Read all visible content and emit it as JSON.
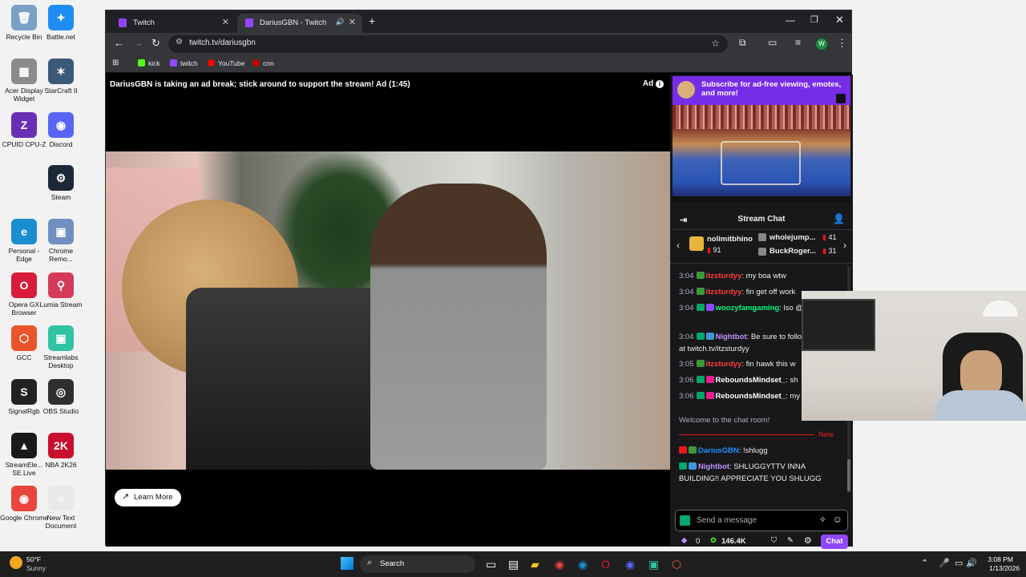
{
  "desktop": {
    "icons": [
      {
        "label": "Recycle Bin",
        "glyph": "🗑",
        "color": "#7aa0c7"
      },
      {
        "label": "Battle.net",
        "glyph": "✦",
        "color": "#1f8cf2"
      },
      {
        "label": "Acer Display Widget",
        "glyph": "▦",
        "color": "#8b8b8b"
      },
      {
        "label": "StarCraft II",
        "glyph": "✶",
        "color": "#3b5a7a"
      },
      {
        "label": "CPUID CPU-Z",
        "glyph": "Z",
        "color": "#6b2fb5"
      },
      {
        "label": "Discord",
        "glyph": "◉",
        "color": "#5865f2"
      },
      {
        "label": "Steam",
        "glyph": "⚙",
        "color": "#1b2838"
      },
      {
        "label": "Personal - Edge",
        "glyph": "e",
        "color": "#1a8fd0"
      },
      {
        "label": "Chrome Remo...",
        "glyph": "▣",
        "color": "#6f8fbf"
      },
      {
        "label": "Opera GX Browser",
        "glyph": "O",
        "color": "#d81b3a"
      },
      {
        "label": "Lumia Stream",
        "glyph": "⚲",
        "color": "#d63a5a"
      },
      {
        "label": "GCC",
        "glyph": "⬡",
        "color": "#e8552a"
      },
      {
        "label": "Streamlabs Desktop",
        "glyph": "▣",
        "color": "#31c3a2"
      },
      {
        "label": "SignalRgb",
        "glyph": "S",
        "color": "#222222"
      },
      {
        "label": "OBS Studio",
        "glyph": "◎",
        "color": "#302e31"
      },
      {
        "label": "StreamEle... SE.Live",
        "glyph": "▲",
        "color": "#1a1a1a"
      },
      {
        "label": "NBA 2K26",
        "glyph": "2K",
        "color": "#c8102e"
      },
      {
        "label": "Google Chrome",
        "glyph": "◉",
        "color": "#e8453c"
      },
      {
        "label": "New Text Document",
        "glyph": "≡",
        "color": "#e9e9e9"
      }
    ]
  },
  "browser": {
    "tabs": [
      {
        "title": "Twitch",
        "active": false
      },
      {
        "title": "DariusGBN - Twitch",
        "active": true
      }
    ],
    "new_tab": "+",
    "url": "twitch.tv/dariusgbn",
    "profile_initial": "W",
    "bookmarks": [
      {
        "label": "kick",
        "color": "#53fc18"
      },
      {
        "label": "twitch",
        "color": "#9147ff"
      },
      {
        "label": "YouTube",
        "color": "#ff0000"
      },
      {
        "label": "cnn",
        "color": "#cc0000"
      }
    ]
  },
  "player": {
    "ad_message": "DariusGBN is taking an ad break; stick around to support the stream! Ad (1:45)",
    "ad_badge": "Ad",
    "learn_more": "Learn More"
  },
  "sidebar": {
    "promo": "Subscribe for ad-free viewing, emotes, and more!",
    "chat_title": "Stream Chat",
    "gifters": [
      {
        "name": "nolimitbhino",
        "count": "91"
      },
      {
        "name": "wholejump...",
        "count": "41"
      },
      {
        "name": "BuckRoger...",
        "count": "31"
      }
    ],
    "messages": [
      {
        "time": "3:04",
        "user": "itzsturdyy",
        "color": "#ff3b3b",
        "text": "my boa wtw"
      },
      {
        "time": "3:04",
        "user": "itzsturdyy",
        "color": "#ff3b3b",
        "text": "fin get off work"
      },
      {
        "time": "3:04",
        "user": "woozyfamgaming",
        "color": "#00ff7f",
        "text": "lso @itzsturdyy"
      },
      {
        "time": "3:04",
        "user": "Nightbot",
        "color": "#bf94ff",
        "text": "Be sure to follow itzsturdyy at twitch.tv/itzsturdyy"
      },
      {
        "time": "3:05",
        "user": "itzsturdyy",
        "color": "#ff3b3b",
        "text": "fin hawk this w"
      },
      {
        "time": "3:06",
        "user": "ReboundsMindset_",
        "color": "#ffffff",
        "text": "sh"
      },
      {
        "time": "3:06",
        "user": "ReboundsMindset_",
        "color": "#ffffff",
        "text": "my sturdyyyyy"
      }
    ],
    "welcome": "Welcome to the chat room!",
    "new_label": "New",
    "recent": [
      {
        "user": "DariusGBN",
        "color": "#1e90ff",
        "text": "!shlugg"
      },
      {
        "user": "Nightbot",
        "color": "#bf94ff",
        "text": "SHLUGGYTTV INNA BUILDING!! APPRECIATE YOU SHLUGG"
      }
    ],
    "composer_placeholder": "Send a message",
    "bits": "0",
    "points": "146.4K",
    "chat_button": "Chat"
  },
  "taskbar": {
    "search": "Search",
    "weather_temp": "50°F",
    "weather_desc": "Sunny",
    "time": "3:08 PM",
    "date": "1/13/2026"
  }
}
